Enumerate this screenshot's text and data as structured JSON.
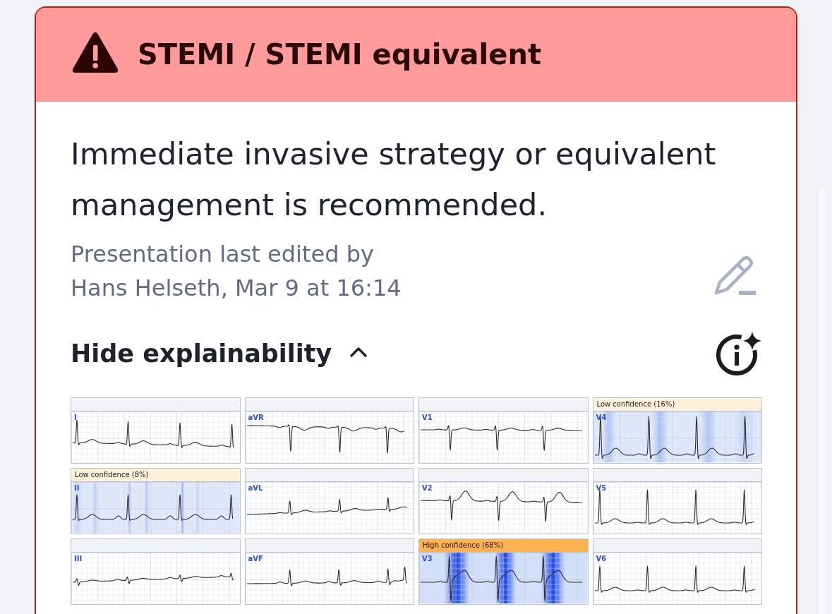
{
  "alert": {
    "title": "STEMI / STEMI equivalent"
  },
  "recommendation": "Immediate invasive strategy or equivalent management is recommended.",
  "edit_note": "Presentation last edited by Hans Helseth, Mar 9 at 16:14",
  "explainability": {
    "toggle_label": "Hide explainability",
    "expanded": true,
    "leads": [
      {
        "lead": "I",
        "kind": "plain"
      },
      {
        "lead": "aVR",
        "kind": "plain"
      },
      {
        "lead": "V1",
        "kind": "plain"
      },
      {
        "lead": "V4",
        "kind": "low",
        "confidence_label": "Low confidence (16%)"
      },
      {
        "lead": "II",
        "kind": "low",
        "confidence_label": "Low confidence (8%)"
      },
      {
        "lead": "aVL",
        "kind": "plain"
      },
      {
        "lead": "V2",
        "kind": "plain"
      },
      {
        "lead": "V5",
        "kind": "plain"
      },
      {
        "lead": "III",
        "kind": "plain"
      },
      {
        "lead": "aVF",
        "kind": "plain"
      },
      {
        "lead": "V3",
        "kind": "high",
        "confidence_label": "High confidence (68%)"
      },
      {
        "lead": "V6",
        "kind": "plain"
      }
    ]
  }
}
